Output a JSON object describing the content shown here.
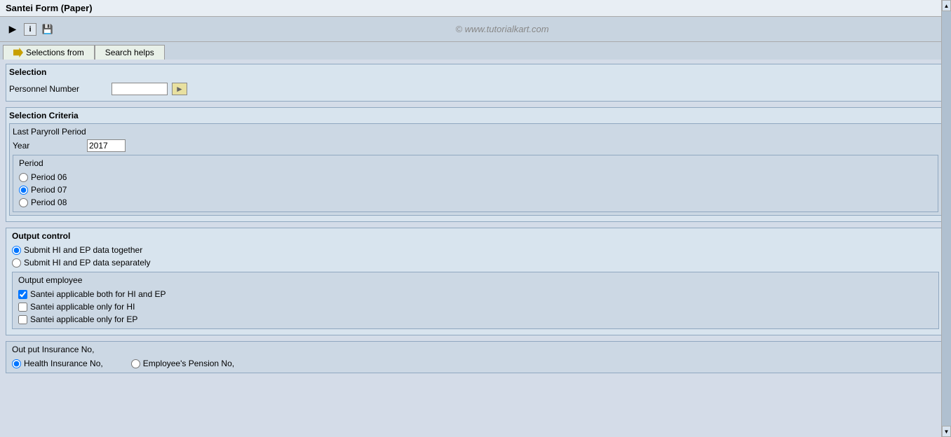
{
  "title": "Santei Form (Paper)",
  "toolbar": {
    "watermark": "© www.tutorialkart.com",
    "icons": [
      "back-icon",
      "info-icon",
      "save-icon"
    ]
  },
  "tabs": [
    {
      "label": "Selections from",
      "active": false,
      "has_arrow": true
    },
    {
      "label": "Search helps",
      "active": false,
      "has_arrow": false
    }
  ],
  "selection_section": {
    "label": "Selection",
    "fields": [
      {
        "label": "Personnel Number",
        "value": "",
        "has_select_btn": true
      }
    ]
  },
  "selection_criteria": {
    "label": "Selection Criteria",
    "last_payroll_period": {
      "label": "Last Paryroll Period",
      "year_label": "Year",
      "year_value": "2017",
      "period_label": "Period",
      "periods": [
        {
          "label": "Period 06",
          "checked": false
        },
        {
          "label": "Period 07",
          "checked": true
        },
        {
          "label": "Period 08",
          "checked": false
        }
      ]
    }
  },
  "output_control": {
    "label": "Output control",
    "submit_options": [
      {
        "label": "Submit HI and EP data together",
        "checked": true
      },
      {
        "label": "Submit HI and EP data separately",
        "checked": false
      }
    ],
    "output_employee": {
      "label": "Output employee",
      "checkboxes": [
        {
          "label": "Santei applicable both for HI and EP",
          "checked": true
        },
        {
          "label": "Santei applicable only for HI",
          "checked": false
        },
        {
          "label": "Santei applicable only for EP",
          "checked": false
        }
      ]
    }
  },
  "output_insurance": {
    "label": "Out put Insurance No,",
    "options": [
      {
        "label": "Health Insurance No,",
        "checked": true
      },
      {
        "label": "Employee's Pension No,",
        "checked": false
      }
    ]
  }
}
